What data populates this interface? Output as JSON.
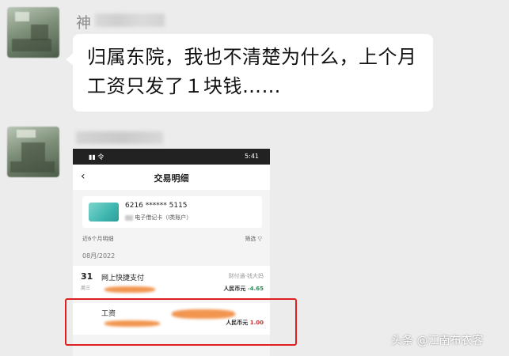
{
  "message1": {
    "sender_visible": "神",
    "text": "归属东院，我也不清楚为什么，上个月工资只发了１块钱……"
  },
  "phone": {
    "status_right": "5:41",
    "nav": {
      "back": "‹",
      "title": "交易明细"
    },
    "card": {
      "number": "6216 ****** 5115",
      "type": "电子借记卡（I类账户）"
    },
    "filter": {
      "range": "近6个月明细",
      "filter_label": "筛选 ▽"
    },
    "month": "08月/2022",
    "transactions": [
      {
        "day": "31",
        "weekday": "周三",
        "desc": "网上快捷支付",
        "source": "财付通-钱大妈",
        "currency": "人民币元",
        "amount": "-4.65"
      },
      {
        "desc": "工资",
        "currency": "人民币元",
        "amount": "1.00"
      }
    ]
  },
  "watermark": "头条 @江南布衣客",
  "colors": {
    "highlight": "#e02020",
    "bg": "#ececec"
  }
}
